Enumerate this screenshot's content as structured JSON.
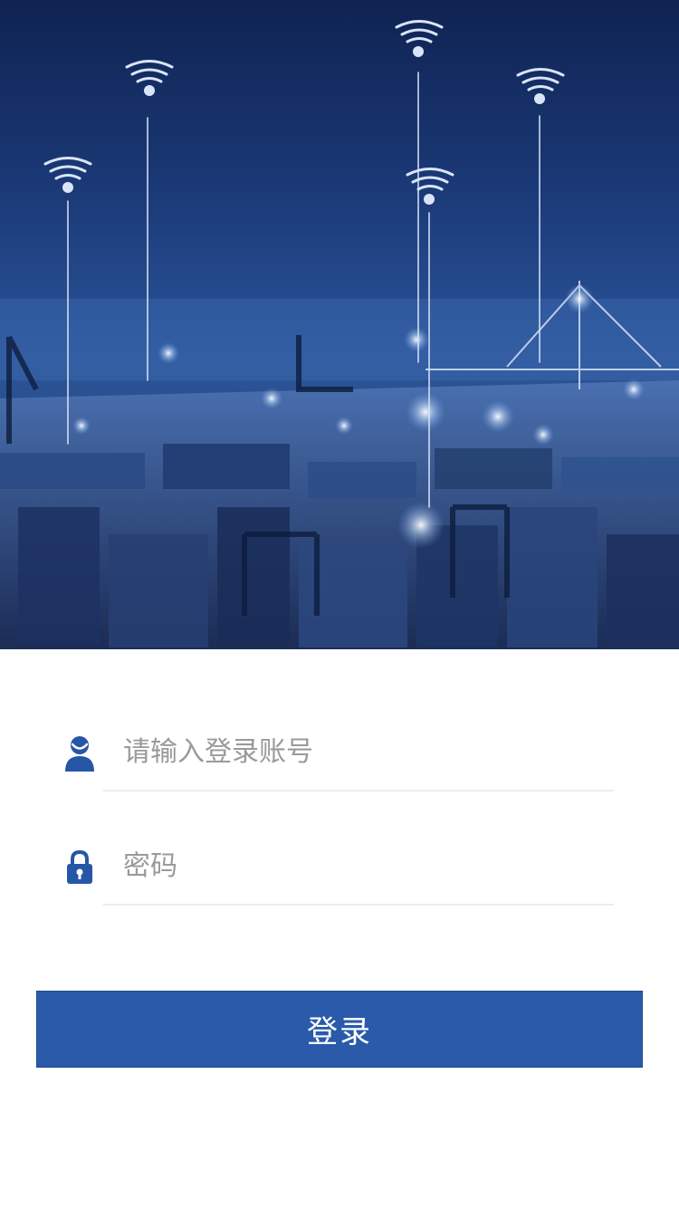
{
  "hero": {
    "image": "port-night-iot-illustration"
  },
  "login": {
    "account_placeholder": "请输入登录账号",
    "password_placeholder": "密码",
    "submit_label": "登录"
  },
  "icons": {
    "account": "user-icon",
    "password": "lock-icon"
  },
  "colors": {
    "accent": "#2a5aa9",
    "icon": "#2656a6",
    "placeholder": "#9a9a9a",
    "divider": "#ececec"
  }
}
